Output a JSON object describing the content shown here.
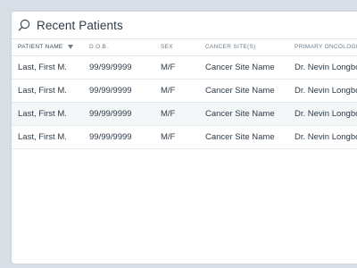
{
  "panel": {
    "title": "Recent Patients",
    "search_icon": "search-icon"
  },
  "table": {
    "columns": [
      "PATIENT NAME",
      "D.O.B.",
      "SEX",
      "CANCER SITE(S)",
      "PRIMARY ONCOLOGIST"
    ],
    "sorted_column_indicator": "sort-arrow-down-icon",
    "rows": [
      [
        "Last, First M.",
        "99/99/9999",
        "M/F",
        "Cancer Site Name",
        "Dr. Nevin Longbottom"
      ],
      [
        "Last, First M.",
        "99/99/9999",
        "M/F",
        "Cancer Site Name",
        "Dr. Nevin Longbottom"
      ],
      [
        "Last, First M.",
        "99/99/9999",
        "M/F",
        "Cancer Site Name",
        "Dr. Nevin Longbottom"
      ],
      [
        "Last, First M.",
        "99/99/9999",
        "M/F",
        "Cancer Site Name",
        "Dr. Nevin Longbottom"
      ]
    ],
    "highlighted_row": 2
  },
  "colors": {
    "background": "#d8dfe6",
    "card": "#ffffff",
    "text": "#2e3b48",
    "header_text": "#6f7c88",
    "row_highlight": "#f3f7f8"
  }
}
